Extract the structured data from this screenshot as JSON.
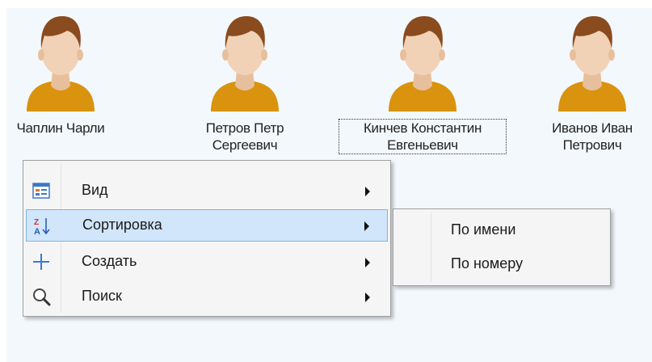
{
  "people": [
    {
      "line1": "Чаплин Чарли",
      "line2": ""
    },
    {
      "line1": "Петров Петр",
      "line2": "Сергеевич"
    },
    {
      "line1": "Кинчев Константин",
      "line2": "Евгеньевич"
    },
    {
      "line1": "Иванов Иван",
      "line2": "Петрович"
    }
  ],
  "context_menu": {
    "items": [
      {
        "label": "Вид",
        "icon": "view-icon"
      },
      {
        "label": "Сортировка",
        "icon": "sort-az-icon"
      },
      {
        "label": "Создать",
        "icon": "plus-icon"
      },
      {
        "label": "Поиск",
        "icon": "magnifier-icon"
      }
    ]
  },
  "sort_submenu": {
    "items": [
      {
        "label": "По имени"
      },
      {
        "label": "По номеру"
      }
    ]
  },
  "colors": {
    "background": "#f3f8fd",
    "highlight": "#d1e6fa",
    "highlight_border": "#7fb4e8",
    "avatar_shirt": "#d9930e",
    "avatar_skin": "#f2d2b6",
    "avatar_hair": "#8a4b1e"
  }
}
